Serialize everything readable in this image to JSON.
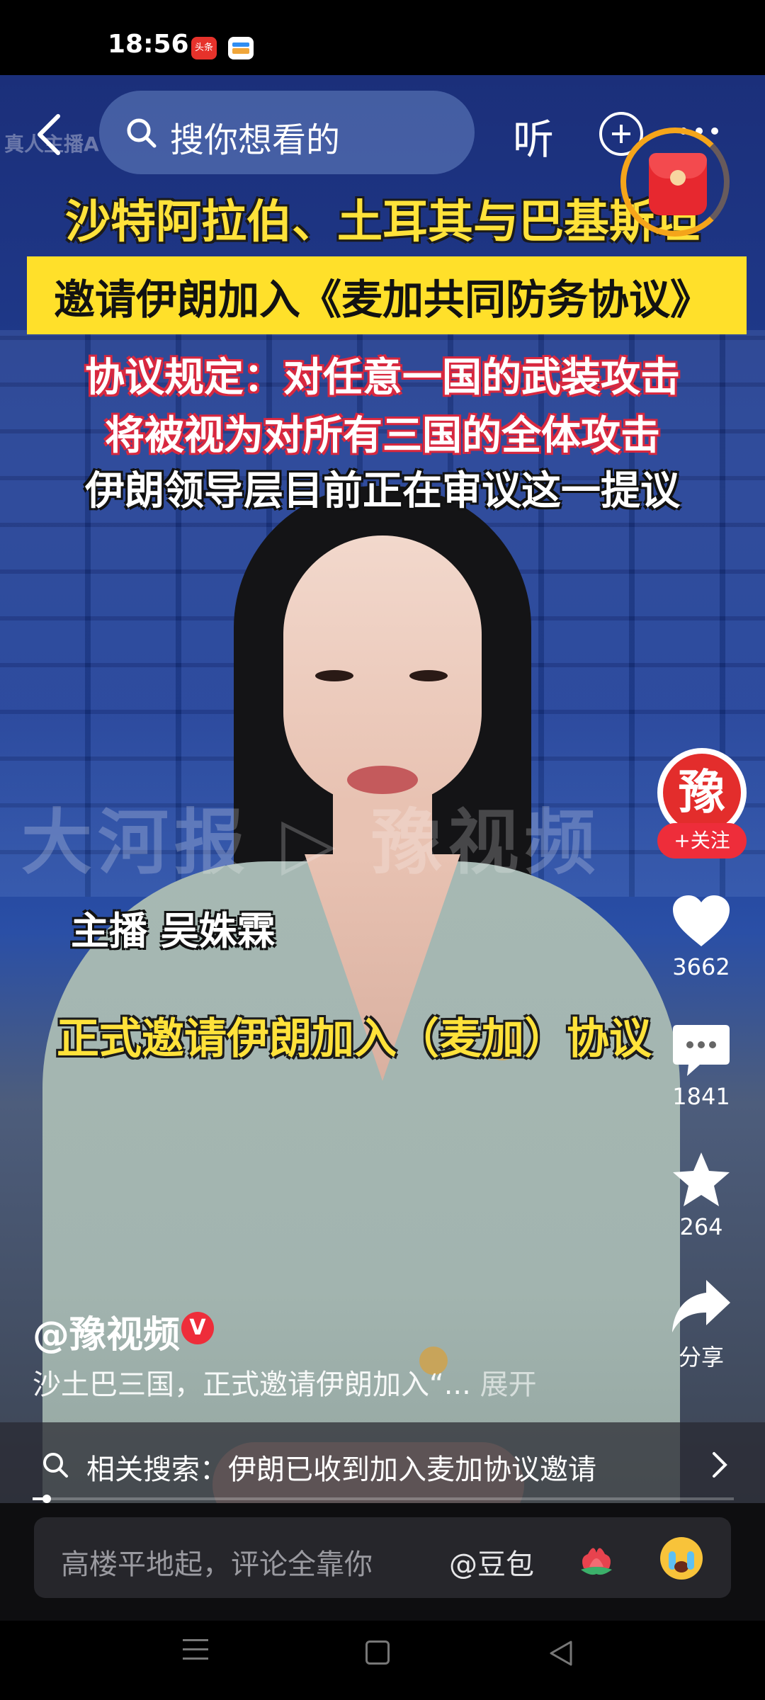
{
  "status_bar": {
    "time": "18:56",
    "app_icons": [
      "toutiao-icon",
      "wallet-icon"
    ],
    "toutiao_label": "头条"
  },
  "top_nav": {
    "search_placeholder": "搜你想看的",
    "listen_label": "听"
  },
  "video": {
    "corner_label": "真人主播A",
    "watermark": "大河报 ▷ 豫视频",
    "captions": [
      "沙特阿拉伯、土耳其与巴基斯坦",
      "邀请伊朗加入《麦加共同防务协议》",
      "协议规定：对任意一国的武装攻击",
      "将被视为对所有三国的全体攻击",
      "伊朗领导层目前正在审议这一提议"
    ],
    "anchor_name": "主播 吴姝霖",
    "bottom_caption": "正式邀请伊朗加入（麦加）协议"
  },
  "actions": {
    "avatar_char": "豫",
    "follow_label": "+关注",
    "likes": "3662",
    "comments": "1841",
    "favorites": "264",
    "share_label": "分享"
  },
  "author": {
    "name": "@豫视频",
    "verified_mark": "V",
    "description": "沙土巴三国，正式邀请伊朗加入“...",
    "expand_label": "展开"
  },
  "related_search": {
    "text": "相关搜索：伊朗已收到加入麦加协议邀请"
  },
  "progress": {
    "fraction": 0.02
  },
  "comment_bar": {
    "placeholder": "高楼平地起，评论全靠你",
    "mention": "@豆包"
  },
  "colors": {
    "accent_red": "#ee2d3a",
    "caption_yellow": "#ffe23a",
    "redpacket_ring": "#f5a51a"
  }
}
